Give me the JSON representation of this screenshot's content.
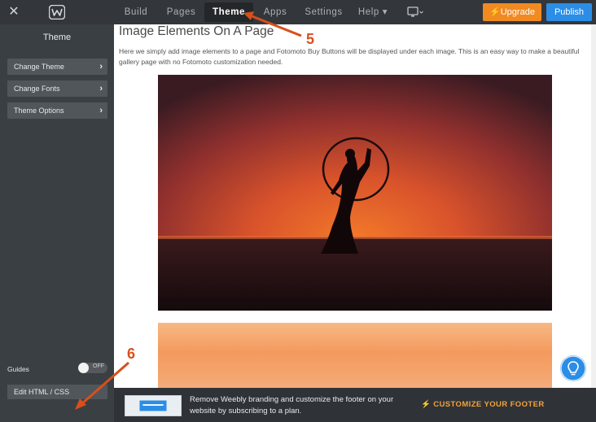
{
  "topbar": {
    "close_icon": "close-icon",
    "logo_icon": "weebly-logo-icon",
    "nav": [
      {
        "label": "Build"
      },
      {
        "label": "Pages"
      },
      {
        "label": "Theme"
      },
      {
        "label": "Apps"
      },
      {
        "label": "Settings"
      },
      {
        "label": "Help ▾"
      }
    ],
    "device_icon": "desktop-device-icon",
    "upgrade_label": "⚡Upgrade",
    "publish_label": "Publish",
    "colors": {
      "upgrade": "#f18a21",
      "publish": "#2b8de6"
    }
  },
  "sidebar": {
    "title": "Theme",
    "items": [
      {
        "label": "Change Theme"
      },
      {
        "label": "Change Fonts"
      },
      {
        "label": "Theme Options"
      }
    ],
    "guides_label": "Guides",
    "guides_toggle": "OFF",
    "edit_html_label": "Edit HTML / CSS"
  },
  "main": {
    "heading": "Image Elements On A Page",
    "description": "Here we simply add image elements to a page and Fotomoto Buy Buttons will be displayed under each image. This is an easy way to make a beautiful gallery page with no Fotomoto customization needed."
  },
  "footer": {
    "text": "Remove Weebly branding and customize the footer on your website by subscribing to a plan.",
    "cta": "⚡  CUSTOMIZE YOUR FOOTER"
  },
  "annotations": {
    "step5": "5",
    "step6": "6",
    "color": "#d84f1a"
  }
}
